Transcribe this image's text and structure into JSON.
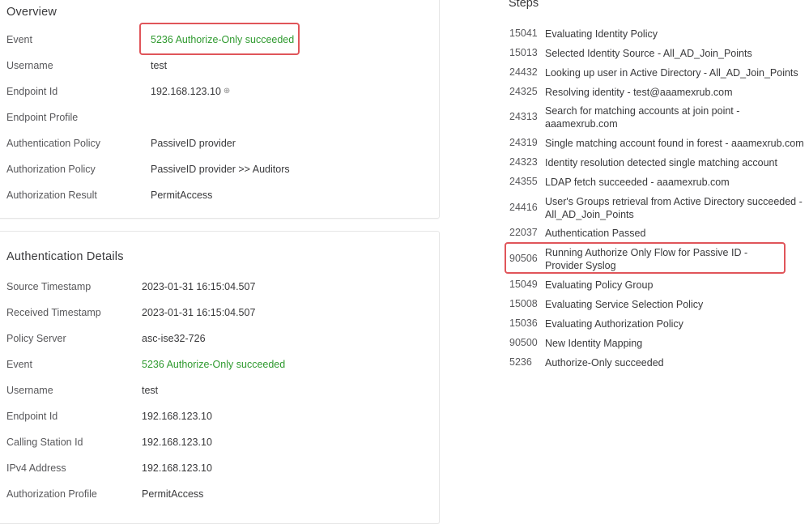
{
  "overview": {
    "title": "Overview",
    "rows": [
      {
        "key": "Event",
        "value": "5236 Authorize-Only succeeded",
        "status": "success"
      },
      {
        "key": "Username",
        "value": "test"
      },
      {
        "key": "Endpoint Id",
        "value": "192.168.123.10",
        "icon": "globe-icon"
      },
      {
        "key": "Endpoint Profile",
        "value": ""
      },
      {
        "key": "Authentication Policy",
        "value": "PassiveID provider"
      },
      {
        "key": "Authorization Policy",
        "value": "PassiveID provider >> Auditors"
      },
      {
        "key": "Authorization Result",
        "value": "PermitAccess"
      }
    ]
  },
  "auth_details": {
    "title": "Authentication Details",
    "rows": [
      {
        "key": "Source Timestamp",
        "value": "2023-01-31 16:15:04.507"
      },
      {
        "key": "Received Timestamp",
        "value": "2023-01-31 16:15:04.507"
      },
      {
        "key": "Policy Server",
        "value": "asc-ise32-726"
      },
      {
        "key": "Event",
        "value": "5236 Authorize-Only succeeded",
        "status": "success"
      },
      {
        "key": "Username",
        "value": "test"
      },
      {
        "key": "Endpoint Id",
        "value": "192.168.123.10"
      },
      {
        "key": "Calling Station Id",
        "value": "192.168.123.10"
      },
      {
        "key": "IPv4 Address",
        "value": "192.168.123.10"
      },
      {
        "key": "Authorization Profile",
        "value": "PermitAccess"
      }
    ]
  },
  "steps": {
    "title": "Steps",
    "items": [
      {
        "code": "15041",
        "desc": "Evaluating Identity Policy"
      },
      {
        "code": "15013",
        "desc": "Selected Identity Source - All_AD_Join_Points"
      },
      {
        "code": "24432",
        "desc": "Looking up user in Active Directory - All_AD_Join_Points"
      },
      {
        "code": "24325",
        "desc": "Resolving identity - test@aaamexrub.com"
      },
      {
        "code": "24313",
        "desc": "Search for matching accounts at join point - aaamexrub.com"
      },
      {
        "code": "24319",
        "desc": "Single matching account found in forest - aaamexrub.com"
      },
      {
        "code": "24323",
        "desc": "Identity resolution detected single matching account"
      },
      {
        "code": "24355",
        "desc": "LDAP fetch succeeded - aaamexrub.com"
      },
      {
        "code": "24416",
        "desc": "User's Groups retrieval from Active Directory succeeded - All_AD_Join_Points"
      },
      {
        "code": "22037",
        "desc": "Authentication Passed"
      },
      {
        "code": "90506",
        "desc": "Running Authorize Only Flow for Passive ID - Provider Syslog",
        "highlighted": true
      },
      {
        "code": "15049",
        "desc": "Evaluating Policy Group"
      },
      {
        "code": "15008",
        "desc": "Evaluating Service Selection Policy"
      },
      {
        "code": "15036",
        "desc": "Evaluating Authorization Policy"
      },
      {
        "code": "90500",
        "desc": "New Identity Mapping"
      },
      {
        "code": "5236",
        "desc": "Authorize-Only succeeded"
      }
    ]
  },
  "colors": {
    "success": "#2f9a2f",
    "highlight_border": "#e0555a"
  }
}
